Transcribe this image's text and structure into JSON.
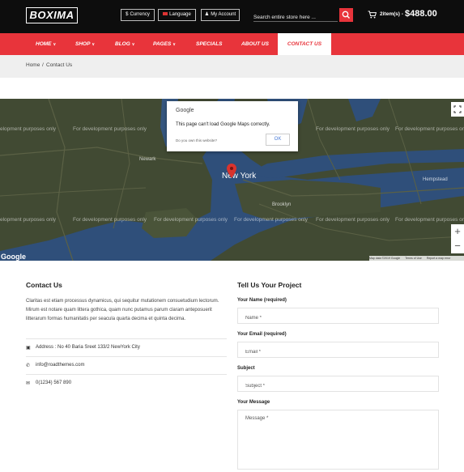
{
  "header": {
    "logo": "BOXIMA",
    "currency_label": "Currency",
    "language_label": "Language",
    "account_label": "My Account",
    "search_placeholder": "Search entire store here ...",
    "cart_count": "2item(s) -",
    "cart_total": "$488.00"
  },
  "nav": {
    "items": [
      "HOME",
      "SHOP",
      "BLOG",
      "PAGES",
      "SPECIALS",
      "ABOUT US",
      "CONTACT US"
    ],
    "active": "CONTACT US"
  },
  "breadcrumb": {
    "home": "Home",
    "separator": "/",
    "current": "Contact Us"
  },
  "map": {
    "dev_text": "For development purposes only",
    "dev_text_partial": "elopment purposes only",
    "labels": {
      "newark": "Newark",
      "new_york": "New York",
      "hempstead": "Hempstead",
      "brooklyn": "Brooklyn"
    },
    "dialog_title": "Google",
    "dialog_message": "This page can't load Google Maps correctly.",
    "dialog_question": "Do you own this website?",
    "dialog_ok": "OK",
    "google_logo": "Google",
    "footer_data": "Map data ©2019 Google",
    "footer_terms": "Terms of Use",
    "footer_report": "Report a map error",
    "zoom_in": "+",
    "zoom_out": "−"
  },
  "contact": {
    "title": "Contact Us",
    "description": "Claritas est etiam processus dynamicus, qui sequitur mutationem consuetudium lectorum. Mirum est notare quam littera gothica, quam nunc putamus parum claram anteposuerit litterarum formas humanitatis per seacula quarta decima et quinta decima.",
    "address": "Address : No 40 Baria Sreet 133/2 NewYork City",
    "email": "info@roadthemes.com",
    "phone": "0(1234) 567 890"
  },
  "form": {
    "title": "Tell Us Your Project",
    "name_label": "Your Name (required)",
    "name_placeholder": "Name *",
    "email_label": "Your Email (required)",
    "email_placeholder": "Email *",
    "subject_label": "Subject",
    "subject_placeholder": "Subject *",
    "message_label": "Your Message",
    "message_placeholder": "Message *"
  },
  "colors": {
    "accent": "#e8343b",
    "topbar": "#0d0d0d",
    "crumb_bg": "#efefef"
  }
}
